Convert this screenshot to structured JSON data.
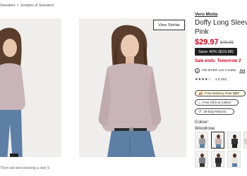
{
  "breadcrumb": {
    "items": [
      "Sweaters",
      "Jumpers & Sweaters"
    ],
    "separator": ">"
  },
  "gallery": {
    "view_similar_label": "View Similar",
    "caption": "75cm tall and wearing a size S"
  },
  "product": {
    "brand": "Vero Moda",
    "title_line1": "Doffy Long Sleev",
    "title_line2": "Pink",
    "price": "$29.97",
    "was_price": "$49.95",
    "save_badge": "Save 40% ($19.98)",
    "sale_ends": "Sale ends: Tomorrow 2",
    "credits_text": "+58 MYER one Credits",
    "credits_join": "Joi",
    "rating_stars": "★★★★☆",
    "rating_value": "4.0 (60)"
  },
  "services": {
    "delivery": "Free Delivery Over $99*",
    "click_collect": "Free Click & Collect",
    "returns": "30-Day Returns"
  },
  "colour": {
    "label": "Colour:",
    "selected_name": "Woodrose"
  },
  "colors": {
    "sale_red": "#d0021b",
    "badge_black": "#1f1f1f",
    "sweater_pink": "#c9b5b7",
    "jeans_blue": "#5d7fa6"
  },
  "icons": {
    "credits": "circle-credit-icon",
    "delivery": "truck-icon",
    "click_collect": "store-icon",
    "returns": "return-arrow-icon"
  }
}
